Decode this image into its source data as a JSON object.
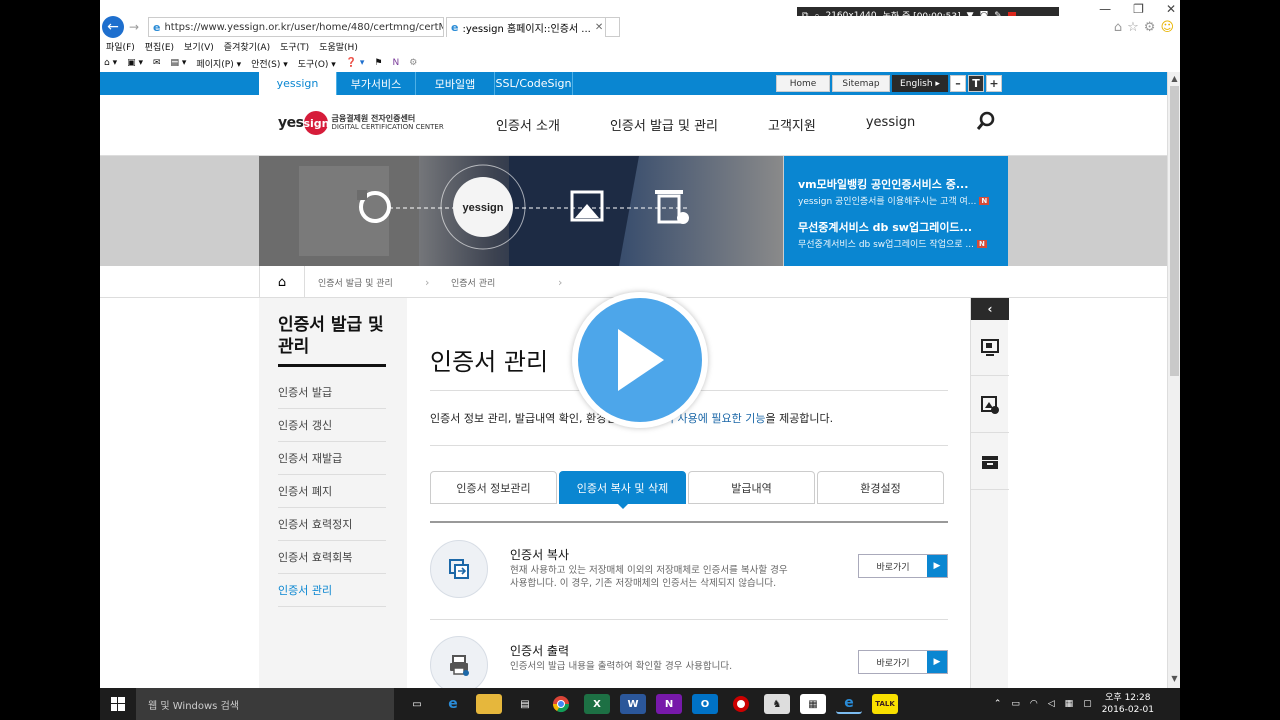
{
  "browser": {
    "url": "https://www.yessign.or.kr/user/home/480/certmng/certM...",
    "tab_title": ":yessign 홈페이지::인증서 ...",
    "menu": [
      "파일(F)",
      "편집(E)",
      "보기(V)",
      "즐겨찾기(A)",
      "도구(T)",
      "도움말(H)"
    ],
    "commands": [
      "페이지(P) ▾",
      "안전(S) ▾",
      "도구(O) ▾"
    ]
  },
  "recorder": {
    "resolution": "2160x1440",
    "status": "녹화 중 [00:00:53]"
  },
  "topnav": [
    "yessign",
    "부가서비스",
    "모바일앱",
    "SSL/CodeSign"
  ],
  "utility": {
    "home": "Home",
    "sitemap": "Sitemap",
    "english": "English ▸",
    "minus": "–",
    "t": "T",
    "plus": "+"
  },
  "logo": {
    "yes": "yes",
    "sign": "sign",
    "line1": "금융결제원 전자인증센터",
    "line2": "DIGITAL CERTIFICATION CENTER"
  },
  "mainnav": [
    "인증서 소개",
    "인증서 발급 및 관리",
    "고객지원",
    "yessign"
  ],
  "banner": {
    "center_logo": "yessign",
    "news": [
      {
        "title": "vm모바일뱅킹 공인인증서비스 중...",
        "desc": "yessign 공인인증서를 이용해주시는 고객 여...",
        "badge": "N"
      },
      {
        "title": "무선중계서비스 db sw업그레이드...",
        "desc": "무선중계서비스 db sw업그레이드 작업으로 ...",
        "badge": "N"
      }
    ]
  },
  "breadcrumb": [
    "인증서 발급 및 관리",
    "인증서 관리"
  ],
  "sidebar": {
    "title": "인증서 발급 및 관리",
    "items": [
      "인증서 발급",
      "인증서 갱신",
      "인증서 재발급",
      "인증서 폐지",
      "인증서 효력정지",
      "인증서 효력회복",
      "인증서 관리"
    ]
  },
  "page": {
    "title": "인증서 관리",
    "desc_before": "인증서 정보 관리, 발급내역 확인, 환경설정 등 ",
    "desc_highlight": "인증서 사용에 필요한 기능",
    "desc_after": "을 제공합니다."
  },
  "tabs": [
    "인증서 정보관리",
    "인증서 복사 및 삭제",
    "발급내역",
    "환경설정"
  ],
  "services": [
    {
      "title": "인증서 복사",
      "desc": "현재 사용하고 있는 저장매체 이외의 저장매체로 인증서를 복사할 경우 사용합니다. 이 경우, 기존 저장매체의 인증서는 삭제되지 않습니다.",
      "button": "바로가기"
    },
    {
      "title": "인증서 출력",
      "desc": "인증서의 발급 내용을 출력하여 확인할 경우 사용합니다.",
      "button": "바로가기"
    }
  ],
  "taskbar": {
    "search": "웹 및 Windows 검색",
    "time": "오후 12:28",
    "date": "2016-02-01"
  }
}
